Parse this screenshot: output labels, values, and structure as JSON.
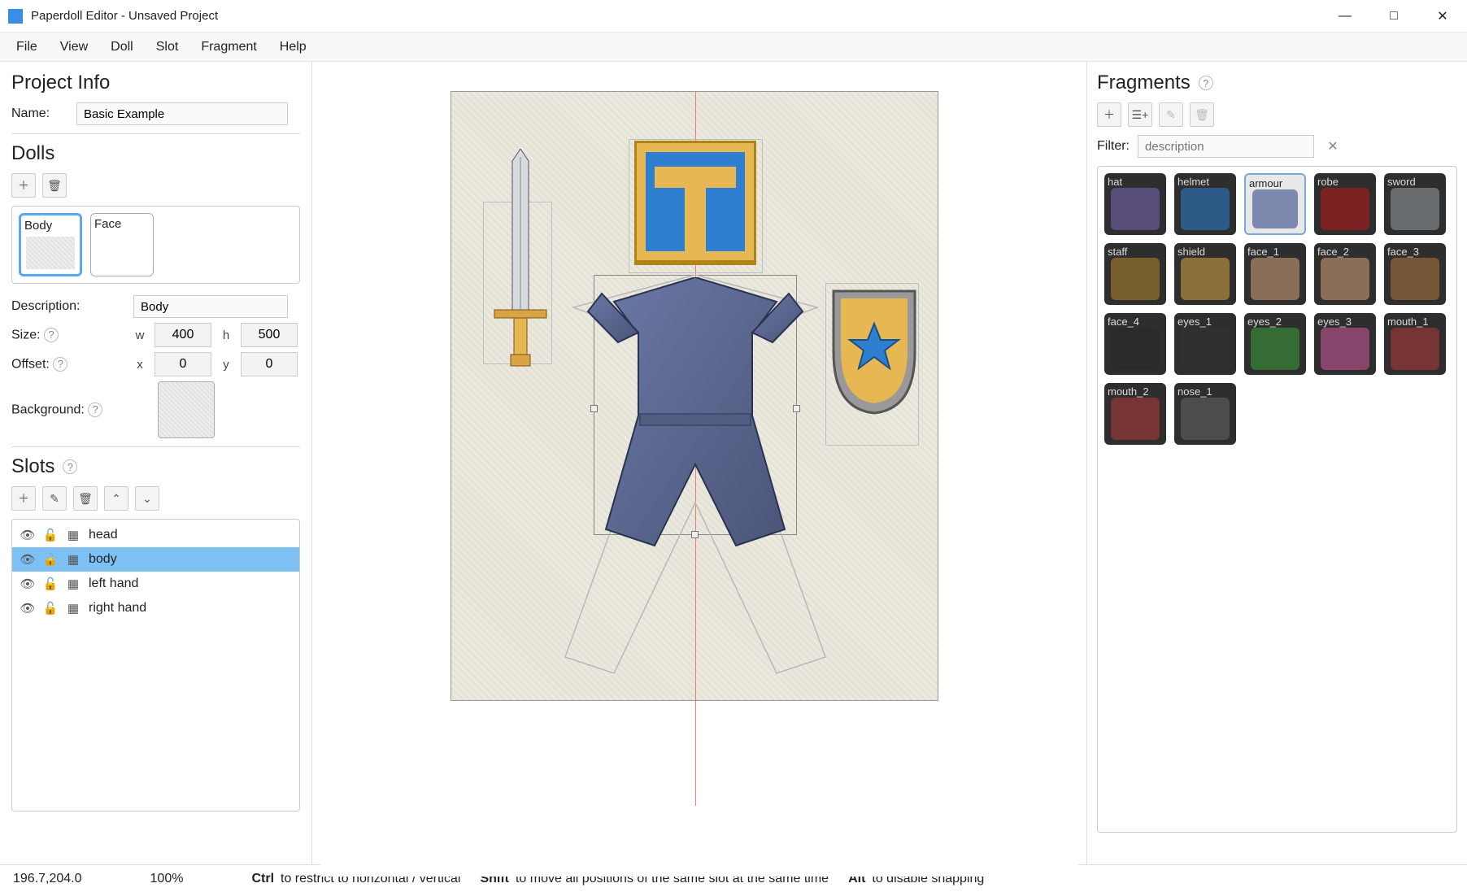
{
  "window": {
    "title": "Paperdoll Editor - Unsaved Project"
  },
  "menu": {
    "items": [
      "File",
      "View",
      "Doll",
      "Slot",
      "Fragment",
      "Help"
    ]
  },
  "project": {
    "heading": "Project Info",
    "name_label": "Name:",
    "name_value": "Basic Example"
  },
  "dolls": {
    "heading": "Dolls",
    "items": [
      {
        "label": "Body",
        "selected": true
      },
      {
        "label": "Face",
        "selected": false
      }
    ],
    "description_label": "Description:",
    "description_value": "Body",
    "size_label": "Size:",
    "size_w_label": "w",
    "size_w_value": "400",
    "size_h_label": "h",
    "size_h_value": "500",
    "offset_label": "Offset:",
    "offset_x_label": "x",
    "offset_x_value": "0",
    "offset_y_label": "y",
    "offset_y_value": "0",
    "background_label": "Background:"
  },
  "slots": {
    "heading": "Slots",
    "items": [
      {
        "name": "head",
        "selected": false
      },
      {
        "name": "body",
        "selected": true
      },
      {
        "name": "left hand",
        "selected": false
      },
      {
        "name": "right hand",
        "selected": false
      }
    ]
  },
  "fragments": {
    "heading": "Fragments",
    "filter_label": "Filter:",
    "filter_placeholder": "description",
    "items": [
      {
        "name": "hat",
        "bright": false,
        "color": "#7b68b8"
      },
      {
        "name": "helmet",
        "bright": false,
        "color": "#2f7fd1"
      },
      {
        "name": "armour",
        "bright": true,
        "color": "#6f7ea8"
      },
      {
        "name": "robe",
        "bright": false,
        "color": "#c01919"
      },
      {
        "name": "sword",
        "bright": false,
        "color": "#9aa0a6"
      },
      {
        "name": "staff",
        "bright": false,
        "color": "#b58a2f"
      },
      {
        "name": "shield",
        "bright": false,
        "color": "#d9a441"
      },
      {
        "name": "face_1",
        "bright": false,
        "color": "#d8a47a"
      },
      {
        "name": "face_2",
        "bright": false,
        "color": "#d8a47a"
      },
      {
        "name": "face_3",
        "bright": false,
        "color": "#b5763f"
      },
      {
        "name": "face_4",
        "bright": false,
        "color": "#2a2a2a"
      },
      {
        "name": "eyes_1",
        "bright": false,
        "color": "#333"
      },
      {
        "name": "eyes_2",
        "bright": false,
        "color": "#3aa03a"
      },
      {
        "name": "eyes_3",
        "bright": false,
        "color": "#d15aa0"
      },
      {
        "name": "mouth_1",
        "bright": false,
        "color": "#b43a3a"
      },
      {
        "name": "mouth_2",
        "bright": false,
        "color": "#b43a3a"
      },
      {
        "name": "nose_1",
        "bright": false,
        "color": "#666"
      }
    ]
  },
  "statusbar": {
    "coords": "196.7,204.0",
    "zoom": "100%",
    "hint1_key": "Ctrl",
    "hint1_text": "to restrict to horizontal / vertical",
    "hint2_key": "Shift",
    "hint2_text": "to move all positions of the same slot at the same time",
    "hint3_key": "Alt",
    "hint3_text": "to disable snapping"
  }
}
